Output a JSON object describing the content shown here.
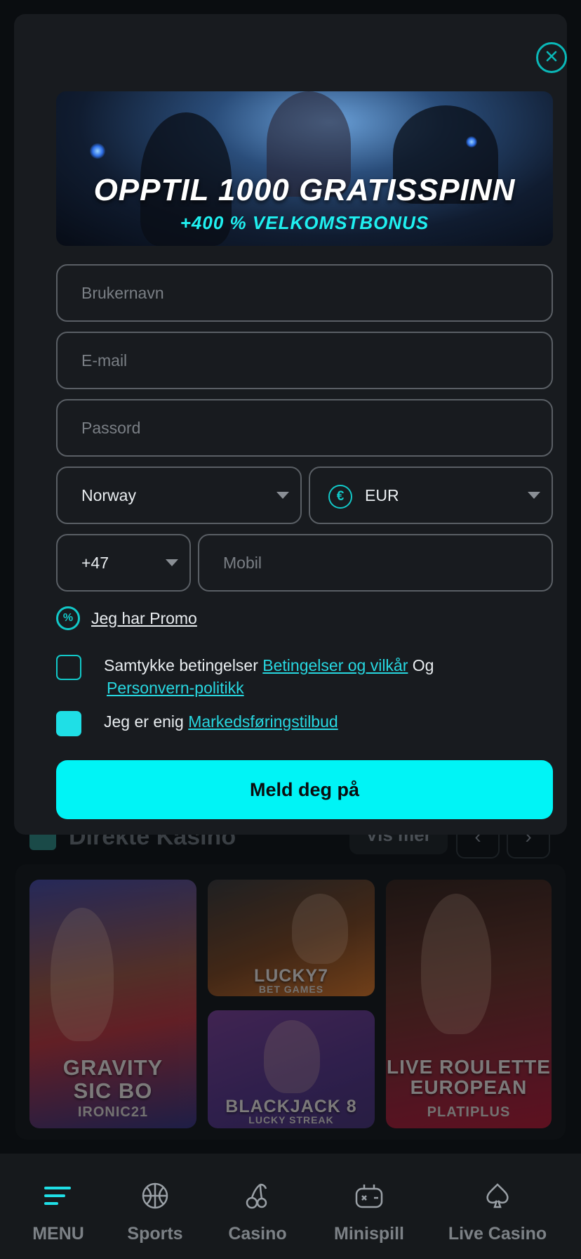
{
  "registration_modal": {
    "banner": {
      "headline": "OPPTIL 1000 GRATISSPINN",
      "subheadline": "+400 % VELKOMSTBONUS"
    },
    "fields": {
      "username_placeholder": "Brukernavn",
      "email_placeholder": "E-mail",
      "password_placeholder": "Passord",
      "country_value": "Norway",
      "currency_value": "EUR",
      "phone_code_value": "+47",
      "mobile_placeholder": "Mobil"
    },
    "promo_label": "Jeg har Promo",
    "terms": {
      "prefix": "Samtykke betingelser",
      "terms_link": "Betingelser og vilkår",
      "joiner": "Og",
      "privacy_link": "Personvern-politikk",
      "checked": false
    },
    "marketing": {
      "prefix": "Jeg er enig",
      "link": "Markedsføringstilbud",
      "checked": true
    },
    "submit_label": "Meld deg på"
  },
  "background": {
    "section_title": "Direkte Kasino",
    "see_more_label": "Vis mer",
    "games": [
      {
        "title": "GRAVITY\nSIC BO",
        "provider": "IRONIC21"
      },
      {
        "title": "LUCKY7",
        "provider": "BET GAMES"
      },
      {
        "title": "BLACKJACK 8",
        "provider": "LUCKY STREAK"
      },
      {
        "title": "LIVE ROULETTE\nEUROPEAN",
        "provider": "PLATIPLUS"
      }
    ]
  },
  "bottom_nav": {
    "items": [
      {
        "label": "MENU",
        "icon": "hamburger-icon",
        "active": true
      },
      {
        "label": "Sports",
        "icon": "basketball-icon",
        "active": false
      },
      {
        "label": "Casino",
        "icon": "cherries-icon",
        "active": false
      },
      {
        "label": "Minispill",
        "icon": "gamepad-icon",
        "active": false
      },
      {
        "label": "Live Casino",
        "icon": "spade-icon",
        "active": false
      }
    ]
  },
  "colors": {
    "accent": "#00f4f6",
    "link": "#27d7e0",
    "modal_bg": "#181b1f",
    "page_bg": "#07090b"
  }
}
